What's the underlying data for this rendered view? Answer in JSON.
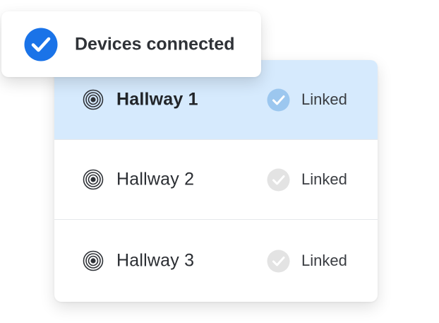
{
  "toast": {
    "message": "Devices connected",
    "icon": "check-circle-icon",
    "icon_color": "#1a73e8"
  },
  "devices": [
    {
      "name": "Hallway 1",
      "status": "Linked",
      "selected": true,
      "icon": "sensor-icon",
      "check_icon": "check-circle-icon",
      "check_color": "#9cc7ef"
    },
    {
      "name": "Hallway 2",
      "status": "Linked",
      "selected": false,
      "icon": "sensor-icon",
      "check_icon": "check-circle-icon",
      "check_color": "#e3e3e3"
    },
    {
      "name": "Hallway 3",
      "status": "Linked",
      "selected": false,
      "icon": "sensor-icon",
      "check_icon": "check-circle-icon",
      "check_color": "#e3e3e3"
    }
  ],
  "colors": {
    "accent": "#1a73e8",
    "selected_row": "#d6eafd"
  }
}
